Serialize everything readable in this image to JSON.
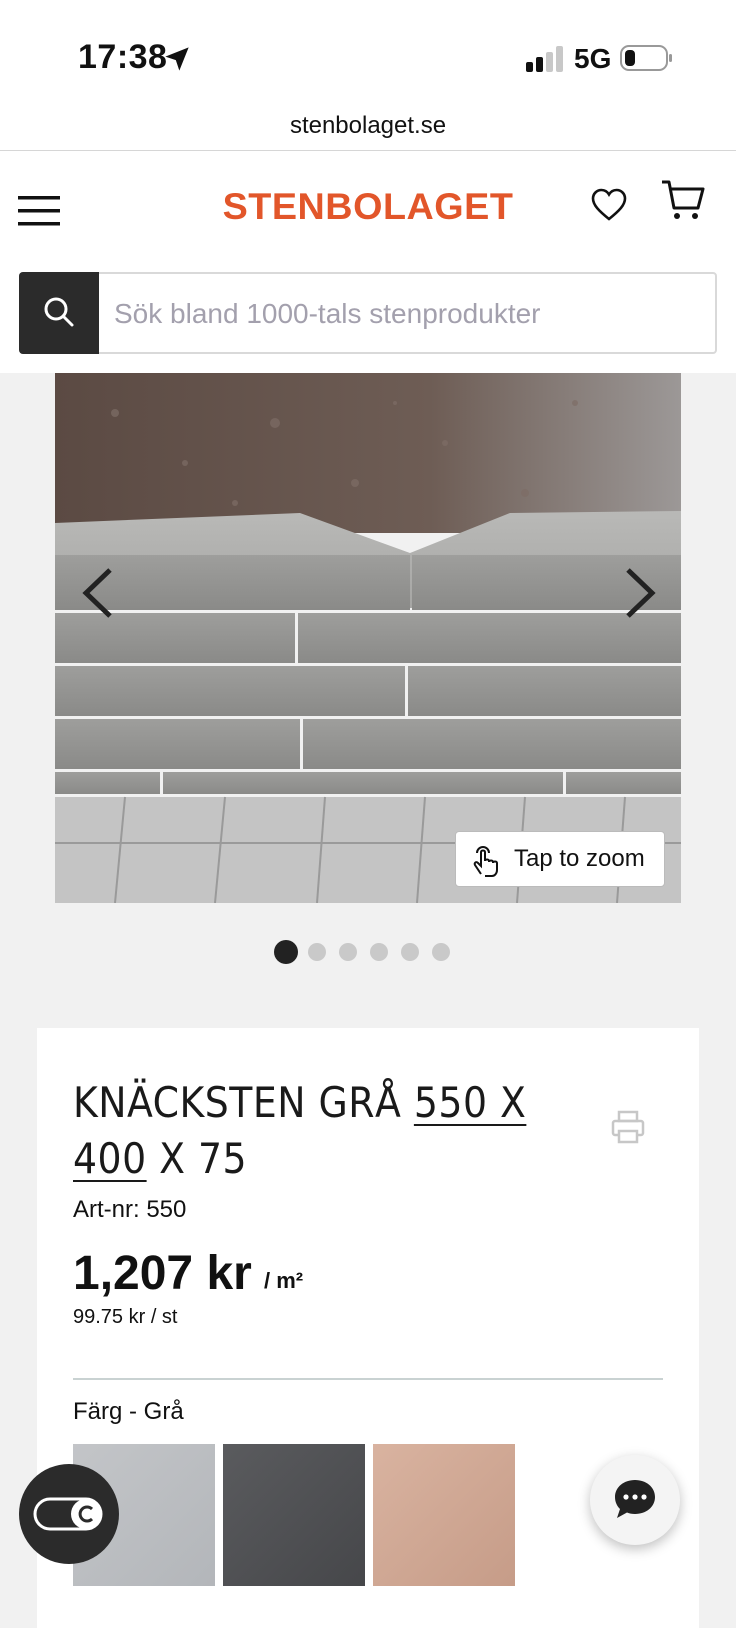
{
  "status_bar": {
    "time": "17:38",
    "network": "5G"
  },
  "browser": {
    "url": "stenbolaget.se"
  },
  "header": {
    "logo": "STENBOLAGET"
  },
  "search": {
    "placeholder": "Sök bland 1000-tals stenprodukter"
  },
  "gallery": {
    "zoom_label": "Tap to zoom",
    "total_images": 6,
    "active_index": 1
  },
  "product": {
    "title_part1": "KNÄCKSTEN GRÅ ",
    "title_part2": "550 X 400",
    "title_part3": " X 75",
    "art_nr": "Art-nr: 550",
    "price": "1,207 kr",
    "unit": "/ m²",
    "price_per_piece": "99.75 kr / st",
    "color_label": "Färg - Grå",
    "swatches": [
      {
        "name": "Grå",
        "color": "#bfc1c4"
      },
      {
        "name": "Svart",
        "color": "#505154"
      },
      {
        "name": "Rödbrun",
        "color": "#d1aa96"
      }
    ]
  },
  "colors": {
    "brand": "#e2562a",
    "dark": "#2b2b2b"
  }
}
